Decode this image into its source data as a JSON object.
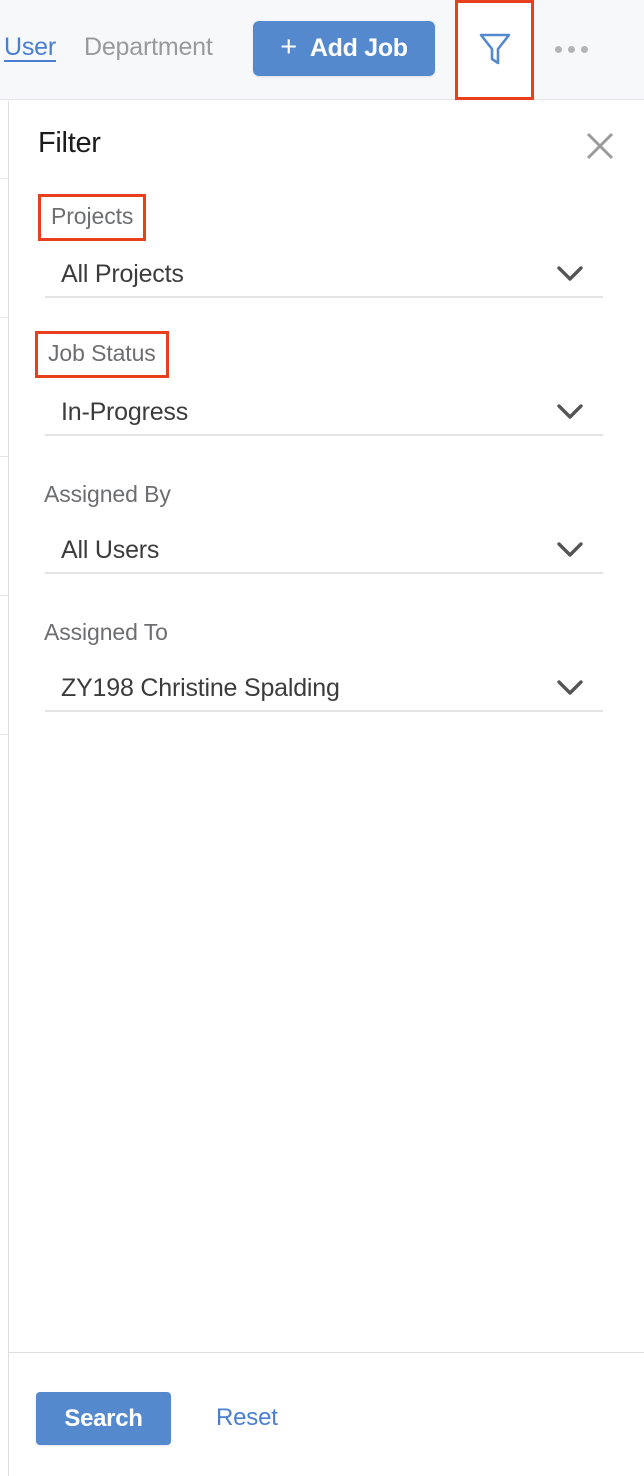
{
  "topbar": {
    "tabs": [
      {
        "label": "User",
        "active": true
      },
      {
        "label": "Department",
        "active": false
      }
    ],
    "add_job_label": "Add Job",
    "add_job_plus": "+",
    "filter_icon": "funnel-icon",
    "overflow_icon": "ellipsis-icon",
    "accent_blue": "#5489ce",
    "link_blue": "#4a7fd0",
    "muted_gray": "#9a9a9a",
    "bar_background": "#f7f8fa"
  },
  "panel": {
    "title": "Filter",
    "close_icon": "close-icon",
    "highlight_color": "#e8401c",
    "fields": [
      {
        "label": "Projects",
        "value": "All Projects",
        "highlighted": true,
        "chevron_icon": "chevron-down-icon"
      },
      {
        "label": "Job Status",
        "value": "In-Progress",
        "highlighted": true,
        "chevron_icon": "chevron-down-icon"
      },
      {
        "label": "Assigned By",
        "value": "All Users",
        "highlighted": false,
        "chevron_icon": "chevron-down-icon"
      },
      {
        "label": "Assigned To",
        "value": "ZY198 Christine Spalding",
        "highlighted": false,
        "chevron_icon": "chevron-down-icon"
      }
    ]
  },
  "footer": {
    "search_label": "Search",
    "reset_label": "Reset"
  }
}
